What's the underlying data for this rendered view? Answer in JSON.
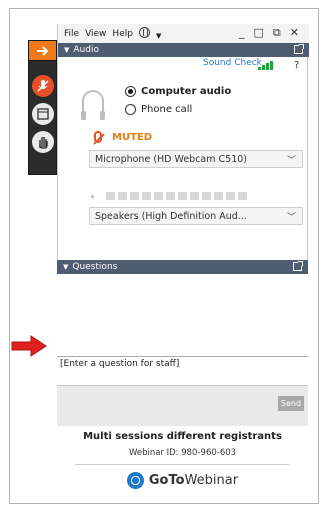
{
  "menu": {
    "file": "File",
    "view": "View",
    "help": "Help",
    "window_controls": {
      "minimize": "_",
      "restore": "□",
      "popout": "⧉",
      "close": "✕"
    }
  },
  "audio": {
    "section_title": "Audio",
    "sound_check": "Sound Check",
    "help": "?",
    "options": [
      {
        "label": "Computer audio",
        "selected": true
      },
      {
        "label": "Phone call",
        "selected": false
      }
    ],
    "muted_label": "MUTED",
    "microphone": "Microphone (HD Webcam C510)",
    "speakers": "Speakers (High Definition Aud...",
    "mic_level_bars": 12
  },
  "questions": {
    "section_title": "Questions",
    "input_placeholder": "[Enter a question for staff]",
    "send_label": "Send"
  },
  "session": {
    "title": "Multi sessions different registrants",
    "webinar_id": "Webinar ID: 980-960-603"
  },
  "brand": {
    "goto": "GoTo",
    "webinar": "Webinar"
  },
  "colors": {
    "section_bar": "#4f5d73",
    "muted": "#e87a14",
    "accent_orange": "#f07a18",
    "link_blue": "#1f78c8",
    "arrow_red": "#e02020"
  }
}
